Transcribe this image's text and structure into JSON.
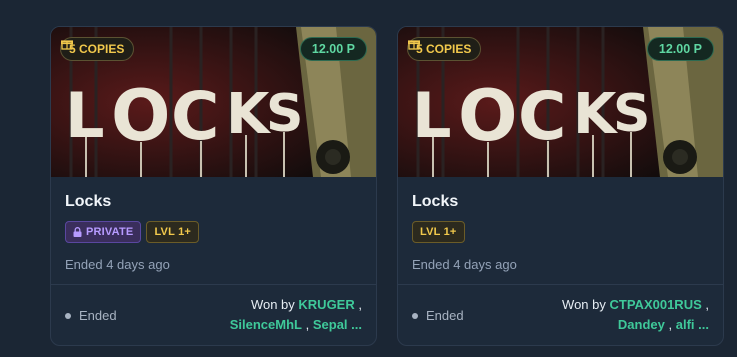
{
  "colors": {
    "background": "#1b2634",
    "card": "#1d2a3a",
    "copies": "#f2c94c",
    "price": "#5fd7a2",
    "private": "#b79bff",
    "winner_name": "#3fc99a"
  },
  "cards": [
    {
      "banner_icon": "locks-artwork",
      "copies_label": "5 COPIES",
      "copies_icon": "gift-icon",
      "price": "12.00 P",
      "title": "Locks",
      "tags": {
        "private": "PRIVATE",
        "level": "LVL 1+"
      },
      "ended_ago": "Ended 4 days ago",
      "status": "Ended",
      "won_by_prefix": "Won by",
      "winners_line1": "KRUGER",
      "winners_line2a": "SilenceMhL",
      "winners_line2b": "Sepal ...",
      "separator": ","
    },
    {
      "banner_icon": "locks-artwork",
      "copies_label": "5 COPIES",
      "copies_icon": "gift-icon",
      "price": "12.00 P",
      "title": "Locks",
      "tags": {
        "level": "LVL 1+"
      },
      "ended_ago": "Ended 4 days ago",
      "status": "Ended",
      "won_by_prefix": "Won by",
      "winners_line1": "CTPAX001RUS",
      "winners_line2a": "Dandey",
      "winners_line2b": "alfi ...",
      "separator": ","
    }
  ]
}
